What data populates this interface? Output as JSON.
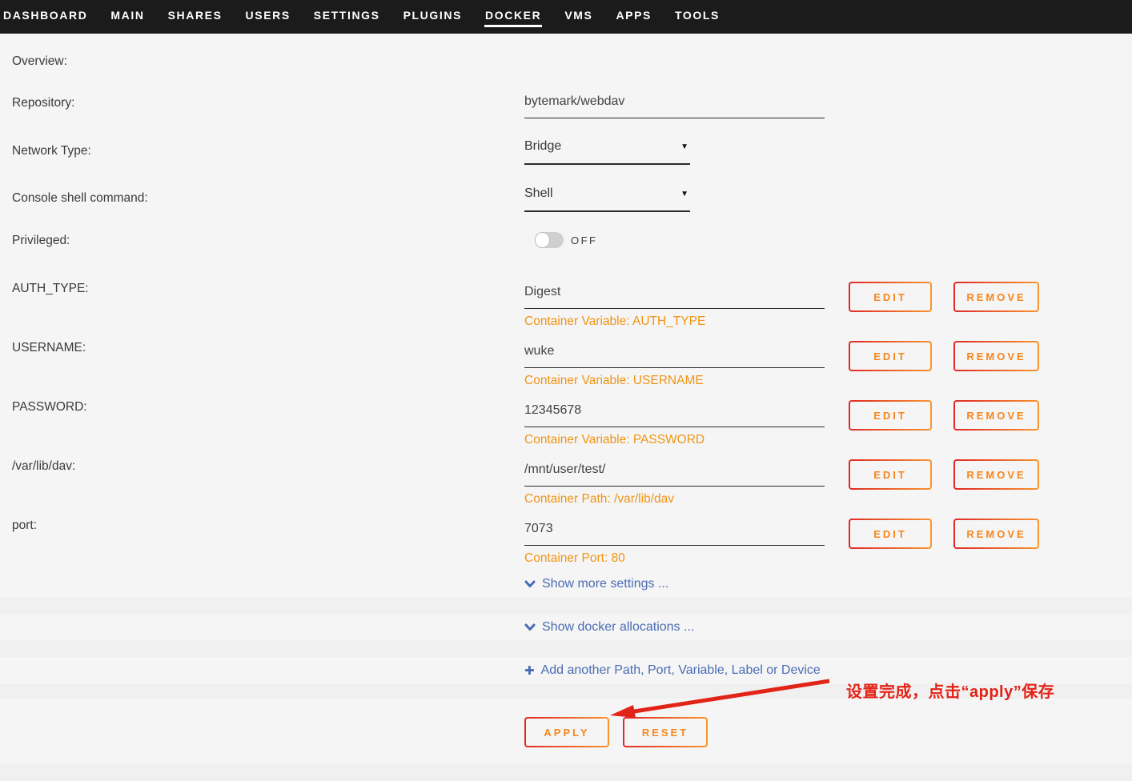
{
  "nav": {
    "tabs": [
      {
        "label": "DASHBOARD"
      },
      {
        "label": "MAIN"
      },
      {
        "label": "SHARES"
      },
      {
        "label": "USERS"
      },
      {
        "label": "SETTINGS"
      },
      {
        "label": "PLUGINS"
      },
      {
        "label": "DOCKER",
        "active": true
      },
      {
        "label": "VMS"
      },
      {
        "label": "APPS"
      },
      {
        "label": "TOOLS"
      }
    ]
  },
  "form": {
    "overview_label": "Overview:",
    "repository": {
      "label": "Repository:",
      "value": "bytemark/webdav"
    },
    "network_type": {
      "label": "Network Type:",
      "value": "Bridge"
    },
    "console_shell": {
      "label": "Console shell command:",
      "value": "Shell"
    },
    "privileged": {
      "label": "Privileged:",
      "state": "OFF"
    },
    "variables": [
      {
        "label": "AUTH_TYPE:",
        "value": "Digest",
        "meta": "Container Variable: AUTH_TYPE"
      },
      {
        "label": "USERNAME:",
        "value": "wuke",
        "meta": "Container Variable: USERNAME"
      },
      {
        "label": "PASSWORD:",
        "value": "12345678",
        "meta": "Container Variable: PASSWORD"
      },
      {
        "label": "/var/lib/dav:",
        "value": "/mnt/user/test/",
        "meta": "Container Path: /var/lib/dav"
      },
      {
        "label": "port:",
        "value": "7073",
        "meta": "Container Port: 80"
      }
    ],
    "edit_label": "EDIT",
    "remove_label": "REMOVE",
    "links": {
      "show_more": "Show more settings ...",
      "show_allocations": "Show docker allocations ...",
      "add_another": "Add another Path, Port, Variable, Label or Device",
      "plus_glyph": "✚"
    },
    "dropdown_caret": "▼",
    "actions": {
      "apply": "APPLY",
      "reset": "RESET"
    }
  },
  "annotation": {
    "text": "设置完成，点击“apply”保存"
  },
  "colors": {
    "nav_bg": "#1c1b1b",
    "page_bg": "#f5f5f5",
    "stripe": "#f0f0f0",
    "orange_meta": "#ef9415",
    "button_text": "#f8861d",
    "button_border_gradient": [
      "#e02828",
      "#f8962e"
    ],
    "link_blue": "#4a6cb3",
    "annotation_red": "#e22318"
  }
}
